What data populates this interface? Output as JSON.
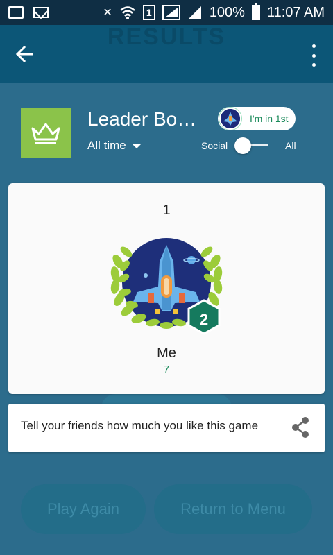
{
  "status_bar": {
    "battery_percent": "100%",
    "time": "11:07 AM",
    "sim_label": "1",
    "icons": [
      "screenshot-icon",
      "mail-icon",
      "mute-icon",
      "wifi-icon",
      "sim-icon",
      "signal-icon",
      "signal-icon",
      "battery-icon"
    ]
  },
  "app_bar": {
    "ghost_title": "RESULTS",
    "back_icon": "arrow-back-icon",
    "menu_icon": "more-vert-icon"
  },
  "leaderboard": {
    "title": "Leader Bo…",
    "filter": "All time",
    "rank_chip": "I'm in 1st",
    "toggle_left": "Social",
    "toggle_right": "All",
    "icon": "crown-icon",
    "accent": "#8bc34a"
  },
  "entry": {
    "rank": "1",
    "level_badge": "2",
    "name": "Me",
    "score": "7",
    "score_color": "#1b8a5a"
  },
  "share": {
    "text": "Tell your friends how much you like this game",
    "icon": "share-icon"
  },
  "buttons": {
    "play_again": "Play Again",
    "return_menu": "Return to Menu"
  }
}
